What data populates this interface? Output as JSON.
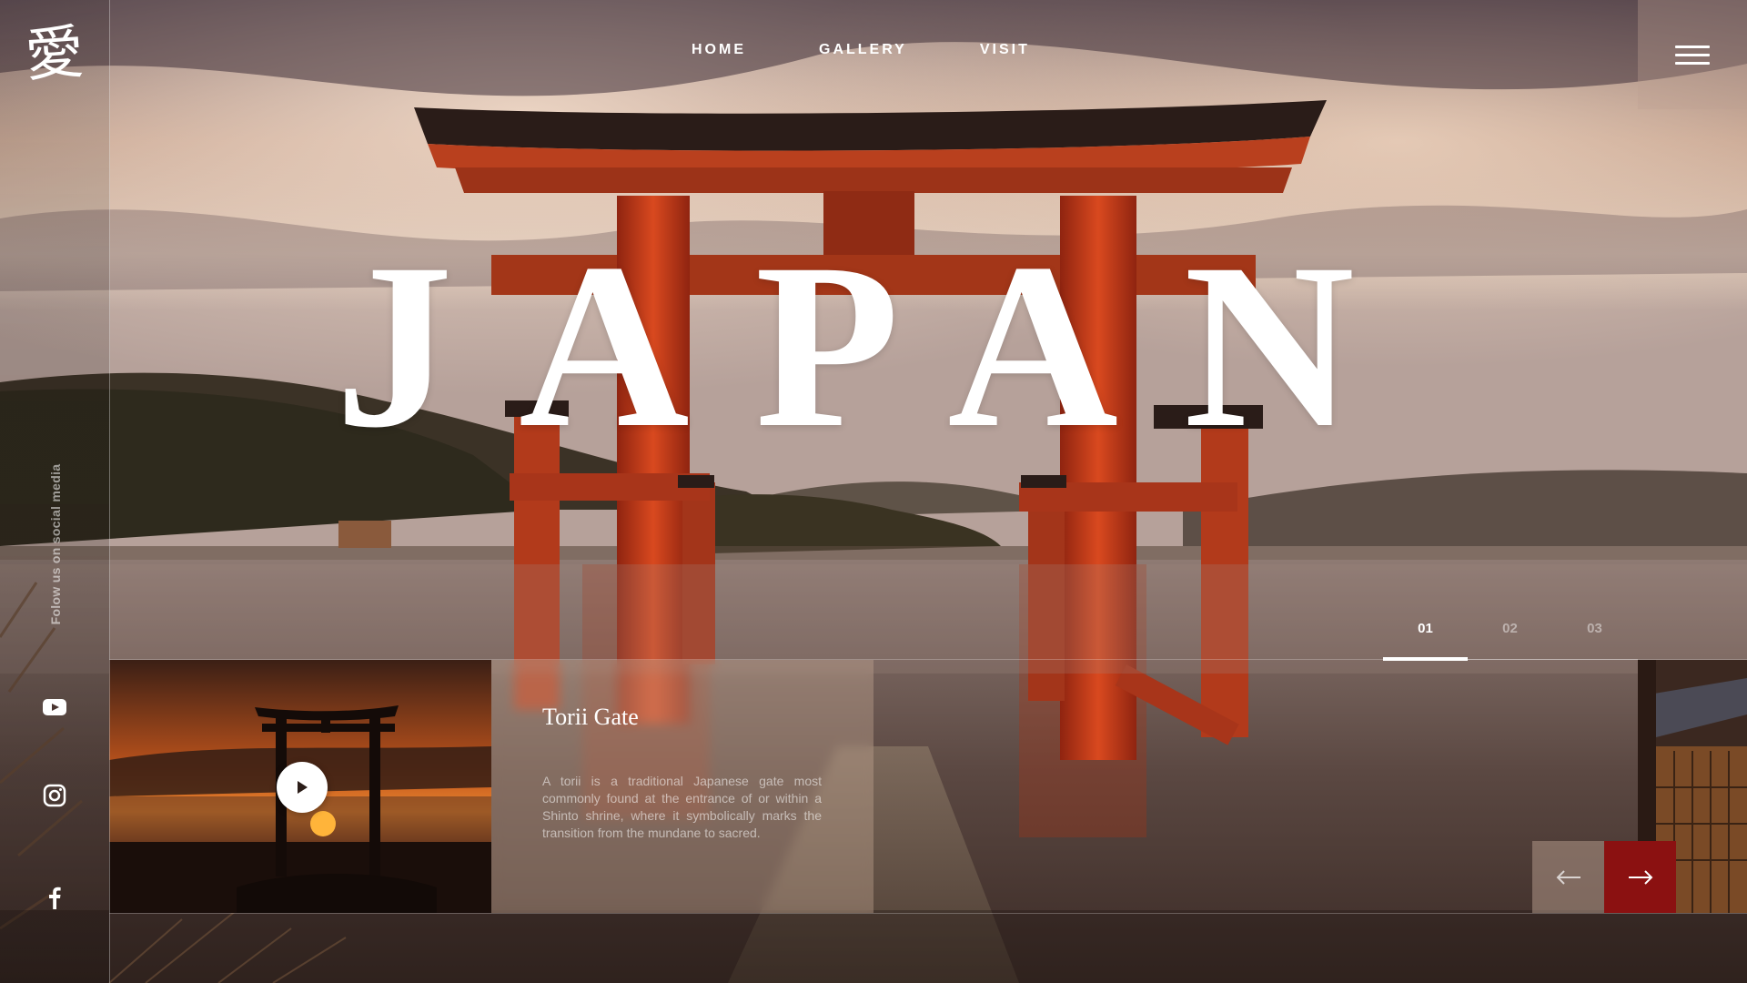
{
  "brand": {
    "logo_glyph": "愛"
  },
  "nav": {
    "items": [
      {
        "label": "HOME"
      },
      {
        "label": "GALLERY"
      },
      {
        "label": "VISIT"
      }
    ]
  },
  "menu": {
    "icon": "hamburger-menu-icon"
  },
  "hero": {
    "title": "JAPAN"
  },
  "social": {
    "label": "Folow us on social media",
    "links": [
      {
        "name": "youtube",
        "icon": "youtube-icon"
      },
      {
        "name": "instagram",
        "icon": "instagram-icon"
      },
      {
        "name": "facebook",
        "icon": "facebook-icon"
      }
    ]
  },
  "slides": {
    "indicators": [
      {
        "label": "01",
        "active": true
      },
      {
        "label": "02",
        "active": false
      },
      {
        "label": "03",
        "active": false
      }
    ]
  },
  "card": {
    "title": "Torii Gate",
    "text": "A torii is a traditional Japanese gate most commonly found at the entrance of or within a Shinto shrine, where it symbolically marks the transition from the mundane to sacred."
  },
  "video": {
    "icon": "play-icon"
  },
  "arrows": {
    "prev_icon": "arrow-left-icon",
    "next_icon": "arrow-right-icon"
  },
  "colors": {
    "accent": "#8b1111",
    "torii_red": "#c23a1a",
    "text": "#ffffff"
  }
}
